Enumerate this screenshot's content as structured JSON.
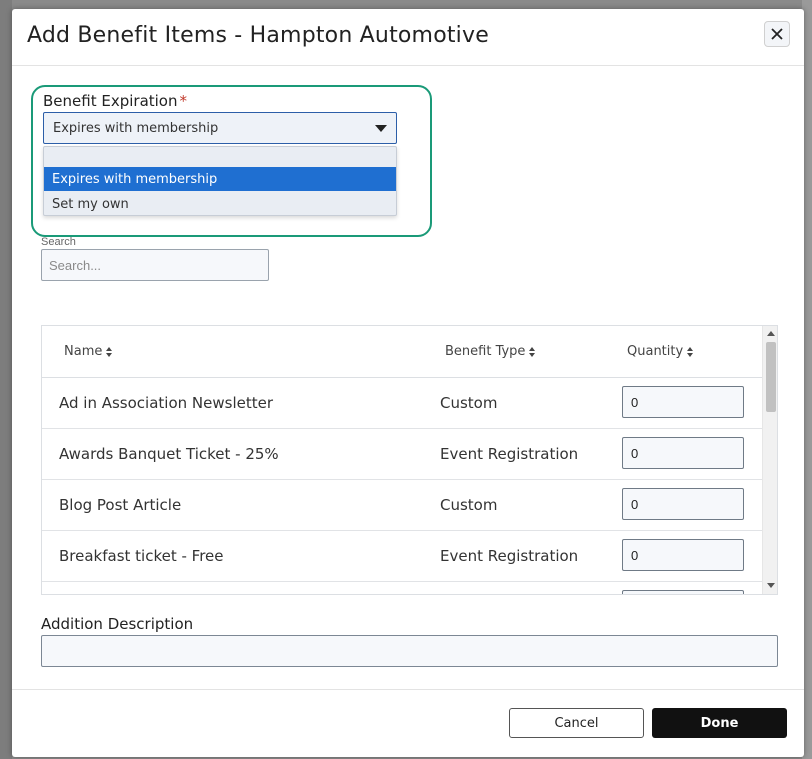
{
  "modal": {
    "title": "Add Benefit Items - Hampton Automotive",
    "close_icon": "close-icon"
  },
  "expiration": {
    "label": "Benefit Expiration",
    "required_mark": "*",
    "selected_value": "Expires with membership",
    "options": [
      "Expires with membership",
      "Set my own"
    ],
    "highlight_color": "#1a9a78"
  },
  "search": {
    "label": "Search",
    "placeholder": "Search..."
  },
  "table": {
    "columns": [
      "Name",
      "Benefit Type",
      "Quantity"
    ],
    "rows": [
      {
        "name": "Ad in Association Newsletter",
        "type": "Custom",
        "quantity": "0"
      },
      {
        "name": "Awards Banquet Ticket - 25%",
        "type": "Event Registration",
        "quantity": "0"
      },
      {
        "name": "Blog Post Article",
        "type": "Custom",
        "quantity": "0"
      },
      {
        "name": "Breakfast ticket - Free",
        "type": "Event Registration",
        "quantity": "0"
      }
    ]
  },
  "description": {
    "label": "Addition Description",
    "value": ""
  },
  "footer": {
    "cancel_label": "Cancel",
    "done_label": "Done"
  },
  "colors": {
    "accent": "#1f6fd1",
    "done_button": "#111111"
  }
}
